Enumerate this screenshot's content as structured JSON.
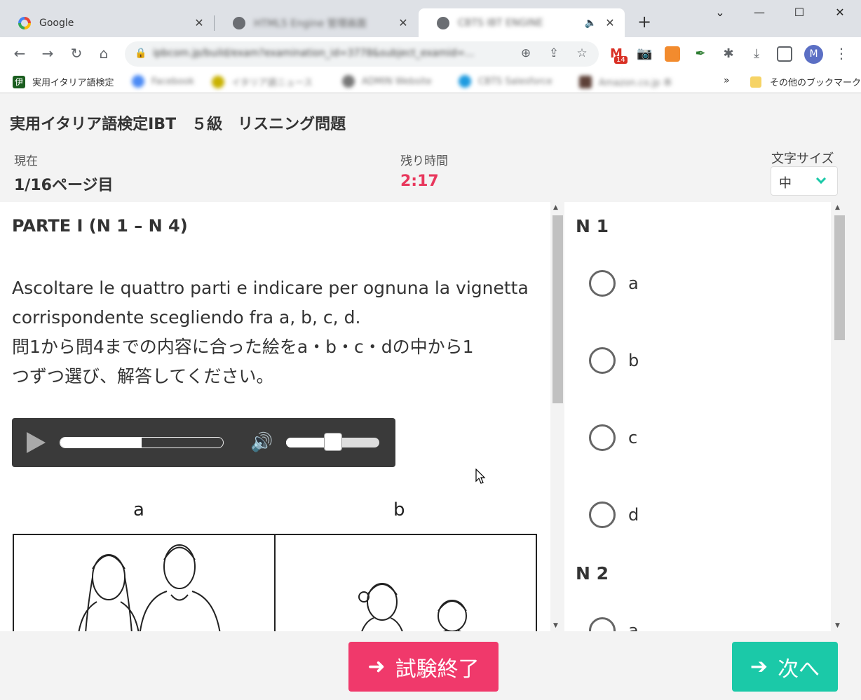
{
  "browser": {
    "tabs": [
      {
        "title": "Google"
      },
      {
        "title": "HTML5 Engine 管理画面"
      },
      {
        "title": "CBTS IBT ENGINE"
      }
    ],
    "url": "ipbcom.jp/build/exam?examination_id=3778&subject_examid=...",
    "notification_count": "14",
    "avatar_letter": "M",
    "bookmarks": [
      {
        "label": "実用イタリア語検定"
      },
      {
        "label": "Facebook"
      },
      {
        "label": "イタリア語ニュース"
      },
      {
        "label": "ADMIN Website"
      },
      {
        "label": "CBTS Salesforce"
      },
      {
        "label": "Amazon.co.jp 本"
      }
    ],
    "bookmarks_more": "»",
    "other_bookmarks": "その他のブックマーク"
  },
  "exam": {
    "title": "実用イタリア語検定IBT　５級　リスニング問題",
    "current_label": "現在",
    "current_value": "1/16ページ目",
    "remaining_label": "残り時間",
    "remaining_value": "2:17",
    "fontsize_label": "文字サイズ",
    "fontsize_value": "中"
  },
  "question": {
    "section": "PARTE I (N 1 – N 4)",
    "instruction_it_1": "Ascoltare le quattro parti e indicare per ognuna la vignetta",
    "instruction_it_2": "corrispondente scegliendo fra a, b, c, d.",
    "instruction_ja_1": "問1から問4までの内容に合った絵をa・b・c・dの中から1",
    "instruction_ja_2": "つずつ選び、解答してください。",
    "picture_labels": [
      "a",
      "b"
    ]
  },
  "audio": {
    "progress": 0.5,
    "volume": 0.5
  },
  "answers": {
    "q1_label": "N 1",
    "q1_options": [
      "a",
      "b",
      "c",
      "d"
    ],
    "q2_label": "N 2",
    "q2_first_option": "a"
  },
  "buttons": {
    "end_exam": "試験終了",
    "next": "次へ"
  },
  "colors": {
    "accent_red": "#f0396b",
    "accent_green": "#1bc9a8",
    "timer": "#e8375c"
  }
}
